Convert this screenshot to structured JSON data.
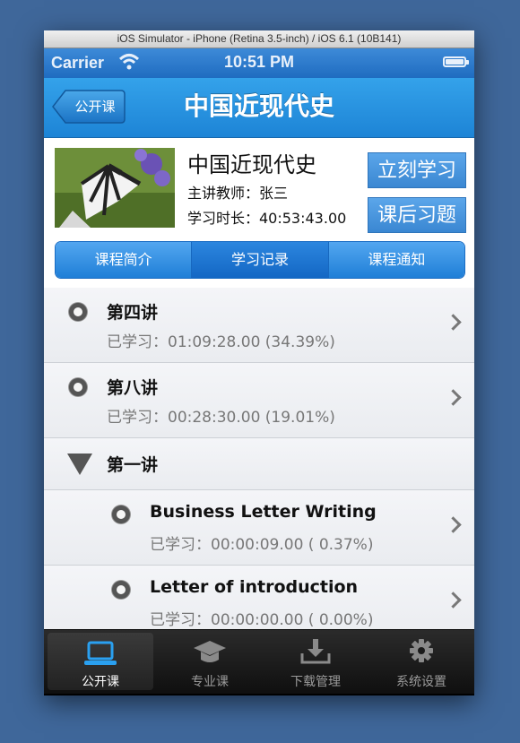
{
  "simulator_title": "iOS Simulator - iPhone (Retina 3.5-inch) / iOS 6.1 (10B141)",
  "status": {
    "carrier": "Carrier",
    "time": "10:51 PM"
  },
  "navbar": {
    "back_label": "公开课",
    "title": "中国近现代史"
  },
  "course": {
    "name": "中国近现代史",
    "teacher": "主讲教师：张三",
    "duration": "学习时长：40:53:43.00",
    "study_now": "立刻学习",
    "exercises": "课后习题"
  },
  "segments": [
    "课程简介",
    "学习记录",
    "课程通知"
  ],
  "active_segment": 1,
  "rows": [
    {
      "title": "第四讲",
      "progress": "已学习：01:09:28.00 (34.39%)"
    },
    {
      "title": "第八讲",
      "progress": "已学习：00:28:30.00 (19.01%)"
    },
    {
      "title": "第一讲"
    },
    {
      "title": "Business Letter Writing",
      "progress": "已学习：00:00:09.00 ( 0.37%)"
    },
    {
      "title": "Letter of introduction",
      "progress": "已学习：00:00:00.00 ( 0.00%)"
    }
  ],
  "tabs": [
    {
      "label": "公开课",
      "icon": "laptop-icon"
    },
    {
      "label": "专业课",
      "icon": "graduation-cap-icon"
    },
    {
      "label": "下载管理",
      "icon": "download-icon"
    },
    {
      "label": "系统设置",
      "icon": "gear-icon"
    }
  ],
  "colors": {
    "accent": "#1d84d6",
    "background": "#3f679a",
    "tab_active_icon": "#2aa0f0"
  }
}
